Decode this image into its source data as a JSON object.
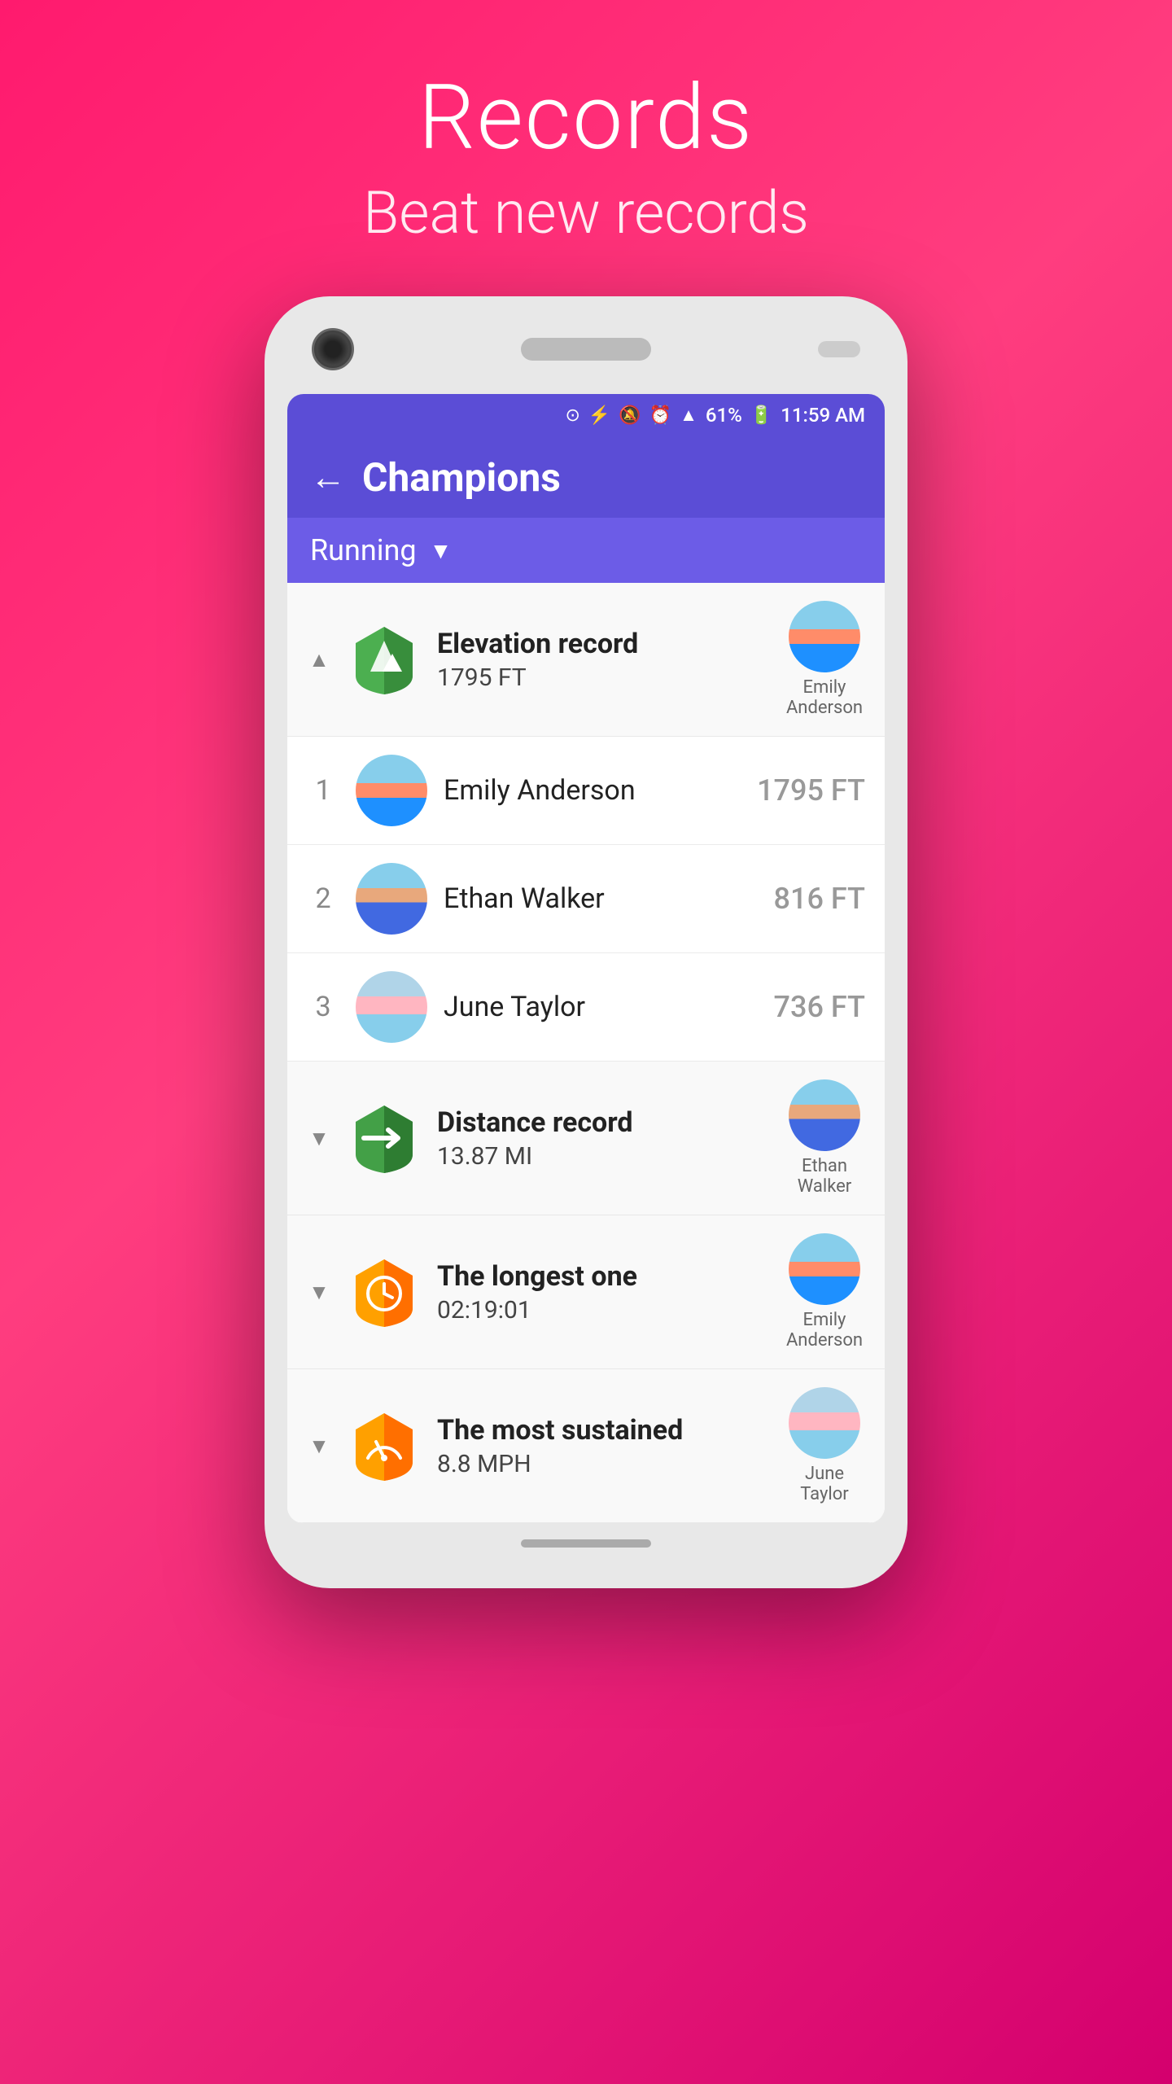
{
  "page": {
    "title": "Records",
    "subtitle": "Beat new records",
    "background_color": "#ff1a6e"
  },
  "status_bar": {
    "battery": "61%",
    "time": "11:59 AM",
    "icons": [
      "location",
      "bluetooth",
      "mute",
      "alarm",
      "wifi",
      "signal",
      "battery",
      "charging"
    ]
  },
  "app_bar": {
    "back_label": "←",
    "title": "Champions"
  },
  "dropdown": {
    "label": "Running",
    "arrow": "▼"
  },
  "categories": [
    {
      "id": "elevation",
      "name": "Elevation record",
      "value": "1795 FT",
      "badge_color_primary": "#4caf50",
      "badge_color_secondary": "#388e3c",
      "badge_icon": "mountain",
      "expanded": true,
      "holder": "Emily Anderson",
      "leaderboard": [
        {
          "rank": 1,
          "name": "Emily Anderson",
          "score": "1795 FT",
          "avatar": "emily"
        },
        {
          "rank": 2,
          "name": "Ethan Walker",
          "score": "816 FT",
          "avatar": "ethan"
        },
        {
          "rank": 3,
          "name": "June Taylor",
          "score": "736 FT",
          "avatar": "june"
        }
      ]
    },
    {
      "id": "distance",
      "name": "Distance record",
      "value": "13.87 MI",
      "badge_color_primary": "#43a047",
      "badge_color_secondary": "#2e7d32",
      "badge_icon": "distance",
      "expanded": false,
      "holder": "Ethan Walker"
    },
    {
      "id": "time",
      "name": "The longest one",
      "value": "02:19:01",
      "badge_color_primary": "#ffa000",
      "badge_color_secondary": "#ff6f00",
      "badge_icon": "clock",
      "expanded": false,
      "holder": "Emily Anderson"
    },
    {
      "id": "speed",
      "name": "The most sustained",
      "value": "8.8 MPH",
      "badge_color_primary": "#ffa000",
      "badge_color_secondary": "#ff6f00",
      "badge_icon": "speed",
      "expanded": false,
      "holder": "June Taylor"
    }
  ]
}
